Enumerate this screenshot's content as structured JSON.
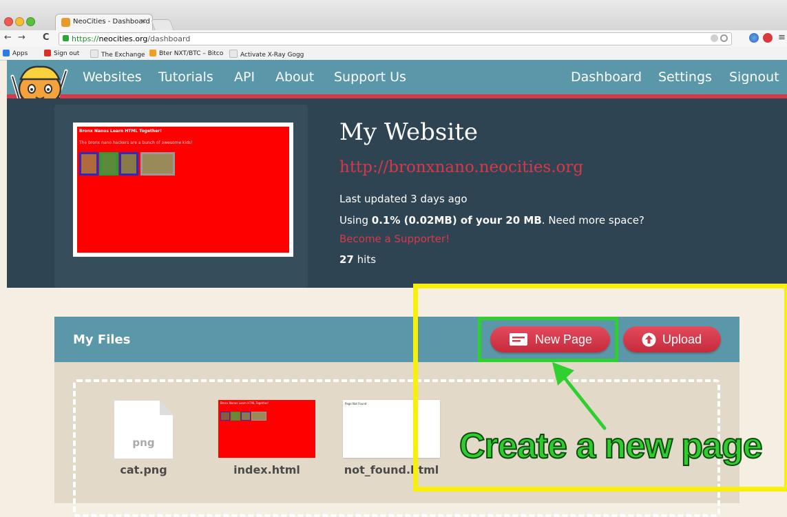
{
  "browser": {
    "tab_title": "NeoCities - Dashboard",
    "tab_close": "×",
    "url_scheme": "https://",
    "url_host": "neocities.org",
    "url_path": "/dashboard",
    "back": "←",
    "forward": "→",
    "reload": "C",
    "menu": "≡"
  },
  "bookmarks": [
    {
      "label": "Apps",
      "color": "#2c7be5"
    },
    {
      "label": "Sign out",
      "color": "#d93025"
    },
    {
      "label": "The Exchange",
      "color": "#e8e8e8"
    },
    {
      "label": "Bter NXT/BTC – Bitco",
      "color": "#f0a020"
    },
    {
      "label": "Activate X-Ray Gogg",
      "color": "#e8e8e8"
    }
  ],
  "nav": {
    "left": [
      "Websites",
      "Tutorials",
      "API",
      "About",
      "Support Us"
    ],
    "right": [
      "Dashboard",
      "Settings",
      "Signout"
    ]
  },
  "site": {
    "preview_title": "Bronx Nanos Learn HTML Together!",
    "preview_subtitle": "The bronx nano hackers are a bunch of awesome kids!",
    "title": "My Website",
    "url": "http://bronxnano.neocities.org",
    "last_updated": "Last updated 3 days ago",
    "usage_prefix": "Using ",
    "usage_bold": "0.1% (0.02MB) of your 20 MB",
    "usage_suffix": ". Need more space?",
    "supporter_link": "Become a Supporter!",
    "hits_count": "27",
    "hits_label": " hits"
  },
  "files": {
    "title": "My Files",
    "new_page_label": "New Page",
    "upload_label": "Upload",
    "items": [
      {
        "name": "cat.png",
        "ext": "png"
      },
      {
        "name": "index.html",
        "thumb_text": "Bronx Nanos Learn HTML Together!"
      },
      {
        "name": "not_found.html",
        "thumb_text": "Page Not Found"
      }
    ]
  },
  "annotation": {
    "text": "Create a new page",
    "highlight_color": "#f7f00b",
    "accent_color": "#2fcf2f"
  },
  "colors": {
    "nav_bg": "#5a97a8",
    "brand_red": "#d6394a",
    "hero_bg": "#2f4452"
  }
}
